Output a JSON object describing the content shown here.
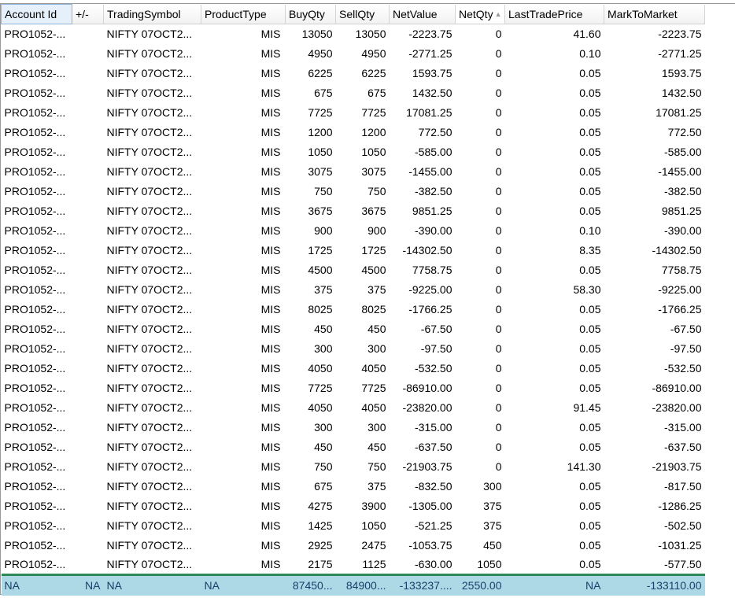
{
  "columns": [
    {
      "label": "Account Id",
      "sorted": false
    },
    {
      "label": "+/-",
      "sorted": false
    },
    {
      "label": "TradingSymbol",
      "sorted": false
    },
    {
      "label": "ProductType",
      "sorted": false
    },
    {
      "label": "BuyQty",
      "sorted": false
    },
    {
      "label": "SellQty",
      "sorted": false
    },
    {
      "label": "NetValue",
      "sorted": false
    },
    {
      "label": "NetQty",
      "sorted": true,
      "sort_direction": "ascending"
    },
    {
      "label": "LastTradePrice",
      "sorted": false
    },
    {
      "label": "MarkToMarket",
      "sorted": false
    }
  ],
  "rows": [
    {
      "account": "PRO1052-...",
      "plusminus": "",
      "symbol": "NIFTY 07OCT2...",
      "product": "MIS",
      "buy": "13050",
      "sell": "13050",
      "netvalue": "-2223.75",
      "netqty": "0",
      "ltp": "41.60",
      "mtm": "-2223.75"
    },
    {
      "account": "PRO1052-...",
      "plusminus": "",
      "symbol": "NIFTY 07OCT2...",
      "product": "MIS",
      "buy": "4950",
      "sell": "4950",
      "netvalue": "-2771.25",
      "netqty": "0",
      "ltp": "0.10",
      "mtm": "-2771.25"
    },
    {
      "account": "PRO1052-...",
      "plusminus": "",
      "symbol": "NIFTY 07OCT2...",
      "product": "MIS",
      "buy": "6225",
      "sell": "6225",
      "netvalue": "1593.75",
      "netqty": "0",
      "ltp": "0.05",
      "mtm": "1593.75"
    },
    {
      "account": "PRO1052-...",
      "plusminus": "",
      "symbol": "NIFTY 07OCT2...",
      "product": "MIS",
      "buy": "675",
      "sell": "675",
      "netvalue": "1432.50",
      "netqty": "0",
      "ltp": "0.05",
      "mtm": "1432.50"
    },
    {
      "account": "PRO1052-...",
      "plusminus": "",
      "symbol": "NIFTY 07OCT2...",
      "product": "MIS",
      "buy": "7725",
      "sell": "7725",
      "netvalue": "17081.25",
      "netqty": "0",
      "ltp": "0.05",
      "mtm": "17081.25"
    },
    {
      "account": "PRO1052-...",
      "plusminus": "",
      "symbol": "NIFTY 07OCT2...",
      "product": "MIS",
      "buy": "1200",
      "sell": "1200",
      "netvalue": "772.50",
      "netqty": "0",
      "ltp": "0.05",
      "mtm": "772.50"
    },
    {
      "account": "PRO1052-...",
      "plusminus": "",
      "symbol": "NIFTY 07OCT2...",
      "product": "MIS",
      "buy": "1050",
      "sell": "1050",
      "netvalue": "-585.00",
      "netqty": "0",
      "ltp": "0.05",
      "mtm": "-585.00"
    },
    {
      "account": "PRO1052-...",
      "plusminus": "",
      "symbol": "NIFTY 07OCT2...",
      "product": "MIS",
      "buy": "3075",
      "sell": "3075",
      "netvalue": "-1455.00",
      "netqty": "0",
      "ltp": "0.05",
      "mtm": "-1455.00"
    },
    {
      "account": "PRO1052-...",
      "plusminus": "",
      "symbol": "NIFTY 07OCT2...",
      "product": "MIS",
      "buy": "750",
      "sell": "750",
      "netvalue": "-382.50",
      "netqty": "0",
      "ltp": "0.05",
      "mtm": "-382.50"
    },
    {
      "account": "PRO1052-...",
      "plusminus": "",
      "symbol": "NIFTY 07OCT2...",
      "product": "MIS",
      "buy": "3675",
      "sell": "3675",
      "netvalue": "9851.25",
      "netqty": "0",
      "ltp": "0.05",
      "mtm": "9851.25"
    },
    {
      "account": "PRO1052-...",
      "plusminus": "",
      "symbol": "NIFTY 07OCT2...",
      "product": "MIS",
      "buy": "900",
      "sell": "900",
      "netvalue": "-390.00",
      "netqty": "0",
      "ltp": "0.10",
      "mtm": "-390.00"
    },
    {
      "account": "PRO1052-...",
      "plusminus": "",
      "symbol": "NIFTY 07OCT2...",
      "product": "MIS",
      "buy": "1725",
      "sell": "1725",
      "netvalue": "-14302.50",
      "netqty": "0",
      "ltp": "8.35",
      "mtm": "-14302.50"
    },
    {
      "account": "PRO1052-...",
      "plusminus": "",
      "symbol": "NIFTY 07OCT2...",
      "product": "MIS",
      "buy": "4500",
      "sell": "4500",
      "netvalue": "7758.75",
      "netqty": "0",
      "ltp": "0.05",
      "mtm": "7758.75"
    },
    {
      "account": "PRO1052-...",
      "plusminus": "",
      "symbol": "NIFTY 07OCT2...",
      "product": "MIS",
      "buy": "375",
      "sell": "375",
      "netvalue": "-9225.00",
      "netqty": "0",
      "ltp": "58.30",
      "mtm": "-9225.00"
    },
    {
      "account": "PRO1052-...",
      "plusminus": "",
      "symbol": "NIFTY 07OCT2...",
      "product": "MIS",
      "buy": "8025",
      "sell": "8025",
      "netvalue": "-1766.25",
      "netqty": "0",
      "ltp": "0.05",
      "mtm": "-1766.25"
    },
    {
      "account": "PRO1052-...",
      "plusminus": "",
      "symbol": "NIFTY 07OCT2...",
      "product": "MIS",
      "buy": "450",
      "sell": "450",
      "netvalue": "-67.50",
      "netqty": "0",
      "ltp": "0.05",
      "mtm": "-67.50"
    },
    {
      "account": "PRO1052-...",
      "plusminus": "",
      "symbol": "NIFTY 07OCT2...",
      "product": "MIS",
      "buy": "300",
      "sell": "300",
      "netvalue": "-97.50",
      "netqty": "0",
      "ltp": "0.05",
      "mtm": "-97.50"
    },
    {
      "account": "PRO1052-...",
      "plusminus": "",
      "symbol": "NIFTY 07OCT2...",
      "product": "MIS",
      "buy": "4050",
      "sell": "4050",
      "netvalue": "-532.50",
      "netqty": "0",
      "ltp": "0.05",
      "mtm": "-532.50"
    },
    {
      "account": "PRO1052-...",
      "plusminus": "",
      "symbol": "NIFTY 07OCT2...",
      "product": "MIS",
      "buy": "7725",
      "sell": "7725",
      "netvalue": "-86910.00",
      "netqty": "0",
      "ltp": "0.05",
      "mtm": "-86910.00"
    },
    {
      "account": "PRO1052-...",
      "plusminus": "",
      "symbol": "NIFTY 07OCT2...",
      "product": "MIS",
      "buy": "4050",
      "sell": "4050",
      "netvalue": "-23820.00",
      "netqty": "0",
      "ltp": "91.45",
      "mtm": "-23820.00"
    },
    {
      "account": "PRO1052-...",
      "plusminus": "",
      "symbol": "NIFTY 07OCT2...",
      "product": "MIS",
      "buy": "300",
      "sell": "300",
      "netvalue": "-315.00",
      "netqty": "0",
      "ltp": "0.05",
      "mtm": "-315.00"
    },
    {
      "account": "PRO1052-...",
      "plusminus": "",
      "symbol": "NIFTY 07OCT2...",
      "product": "MIS",
      "buy": "450",
      "sell": "450",
      "netvalue": "-637.50",
      "netqty": "0",
      "ltp": "0.05",
      "mtm": "-637.50"
    },
    {
      "account": "PRO1052-...",
      "plusminus": "",
      "symbol": "NIFTY 07OCT2...",
      "product": "MIS",
      "buy": "750",
      "sell": "750",
      "netvalue": "-21903.75",
      "netqty": "0",
      "ltp": "141.30",
      "mtm": "-21903.75"
    },
    {
      "account": "PRO1052-...",
      "plusminus": "",
      "symbol": "NIFTY 07OCT2...",
      "product": "MIS",
      "buy": "675",
      "sell": "375",
      "netvalue": "-832.50",
      "netqty": "300",
      "ltp": "0.05",
      "mtm": "-817.50"
    },
    {
      "account": "PRO1052-...",
      "plusminus": "",
      "symbol": "NIFTY 07OCT2...",
      "product": "MIS",
      "buy": "4275",
      "sell": "3900",
      "netvalue": "-1305.00",
      "netqty": "375",
      "ltp": "0.05",
      "mtm": "-1286.25"
    },
    {
      "account": "PRO1052-...",
      "plusminus": "",
      "symbol": "NIFTY 07OCT2...",
      "product": "MIS",
      "buy": "1425",
      "sell": "1050",
      "netvalue": "-521.25",
      "netqty": "375",
      "ltp": "0.05",
      "mtm": "-502.50"
    },
    {
      "account": "PRO1052-...",
      "plusminus": "",
      "symbol": "NIFTY 07OCT2...",
      "product": "MIS",
      "buy": "2925",
      "sell": "2475",
      "netvalue": "-1053.75",
      "netqty": "450",
      "ltp": "0.05",
      "mtm": "-1031.25"
    },
    {
      "account": "PRO1052-...",
      "plusminus": "",
      "symbol": "NIFTY 07OCT2...",
      "product": "MIS",
      "buy": "2175",
      "sell": "1125",
      "netvalue": "-630.00",
      "netqty": "1050",
      "ltp": "0.05",
      "mtm": "-577.50"
    }
  ],
  "footer": {
    "account": "NA",
    "plusminus": "NA",
    "symbol": "NA",
    "product": "NA",
    "buy": "87450...",
    "sell": "84900...",
    "netvalue": "-133237....",
    "netqty": "2550.00",
    "ltp": "NA",
    "mtm": "-133110.00"
  },
  "colors": {
    "footer_bg": "#add8e6",
    "footer_border": "#2e8b57",
    "footer_text": "#1a3f6b"
  }
}
